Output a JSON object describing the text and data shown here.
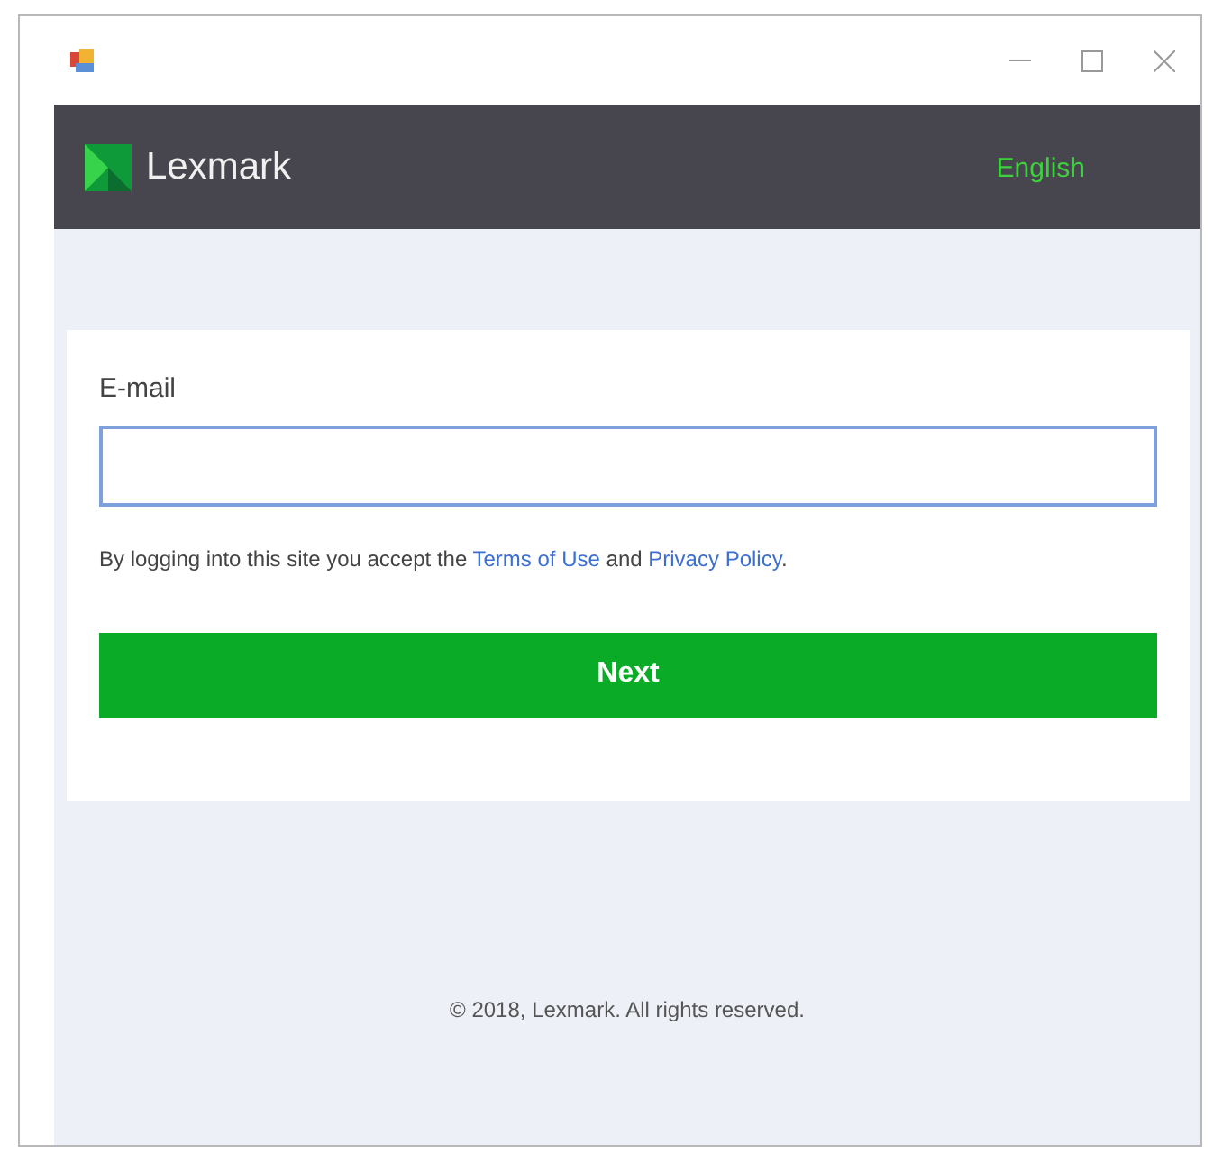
{
  "header": {
    "brand": "Lexmark",
    "language": "English"
  },
  "form": {
    "label": "E-mail",
    "terms": [
      {
        "kind": "text",
        "text": "By logging into this site you accept the "
      },
      {
        "kind": "link",
        "text": "Terms of Use"
      },
      {
        "kind": "text",
        "text": " and "
      },
      {
        "kind": "link",
        "text": "Privacy Policy"
      },
      {
        "kind": "text",
        "text": "."
      }
    ],
    "button": "Next"
  },
  "footer": "© 2018, Lexmark. All rights reserved."
}
